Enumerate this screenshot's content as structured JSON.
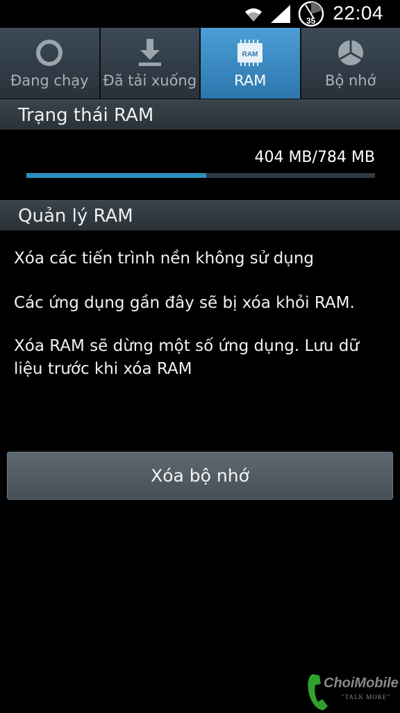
{
  "status_bar": {
    "icons": [
      "wifi-icon",
      "signal-icon",
      "battery-icon"
    ],
    "battery_level": "35",
    "time": "22:04"
  },
  "tabs": [
    {
      "label": "Đang chạy",
      "icon": "running-ring-icon",
      "active": false
    },
    {
      "label": "Đã tải xuống",
      "icon": "download-icon",
      "active": false
    },
    {
      "label": "RAM",
      "icon": "ram-chip-icon",
      "active": true
    },
    {
      "label": "Bộ nhớ",
      "icon": "storage-pie-icon",
      "active": false
    }
  ],
  "ram_chip_text": "RAM",
  "ram_status": {
    "header": "Trạng thái RAM",
    "usage": "404 MB/784 MB",
    "used_fraction": 0.515
  },
  "ram_management": {
    "header": "Quản lý RAM",
    "lines": [
      "Xóa các tiến trình nền không sử dụng",
      "Các ứng dụng gần đây sẽ bị xóa khỏi RAM.",
      "Xóa RAM sẽ dừng một số ứng dụng. Lưu dữ liệu trước khi xóa RAM"
    ],
    "clear_button": "Xóa bộ nhớ"
  },
  "watermark": {
    "brand": "ChoiMobile",
    "tagline": "\"TALK MORE\""
  },
  "colors": {
    "active_tab": "#3a8ac4",
    "progress_fill": "#2e8fbf",
    "background": "#000000"
  }
}
